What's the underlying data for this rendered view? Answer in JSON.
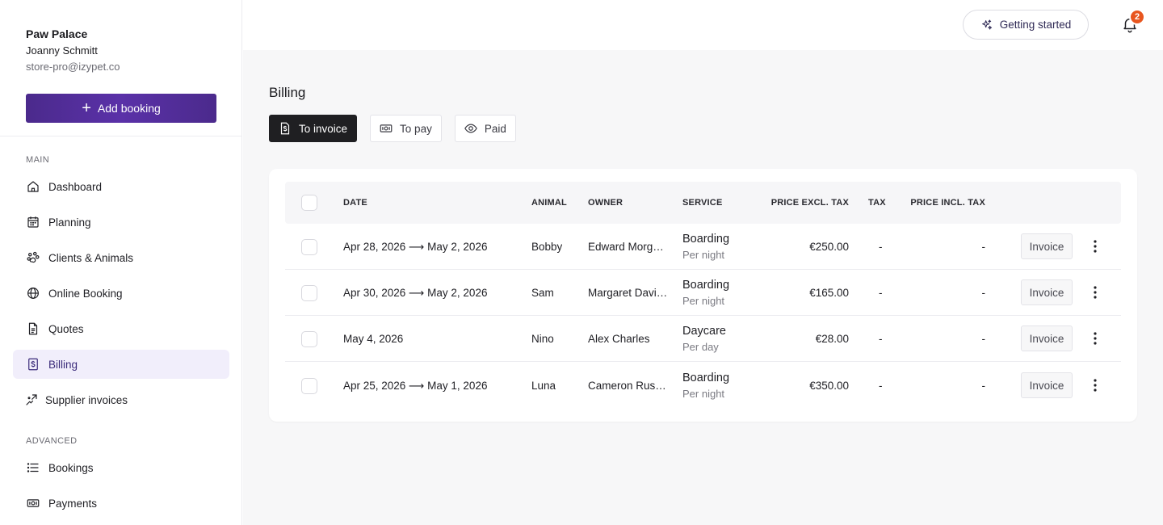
{
  "sidebar": {
    "store_name": "Paw Palace",
    "user_name": "Joanny Schmitt",
    "email": "store-pro@izypet.co",
    "add_booking_label": "Add booking",
    "main_label": "MAIN",
    "advanced_label": "ADVANCED",
    "main_items": [
      {
        "label": "Dashboard",
        "icon": "home-icon"
      },
      {
        "label": "Planning",
        "icon": "calendar-icon"
      },
      {
        "label": "Clients & Animals",
        "icon": "paw-icon"
      },
      {
        "label": "Online Booking",
        "icon": "globe-icon"
      },
      {
        "label": "Quotes",
        "icon": "document-icon"
      },
      {
        "label": "Billing",
        "icon": "dollar-file-icon",
        "active": true
      },
      {
        "label": "Supplier invoices",
        "icon": "supplier-icon"
      }
    ],
    "advanced_items": [
      {
        "label": "Bookings",
        "icon": "list-icon"
      },
      {
        "label": "Payments",
        "icon": "cash-icon"
      }
    ]
  },
  "topbar": {
    "getting_started_label": "Getting started",
    "notification_count": "2"
  },
  "main": {
    "title": "Billing",
    "tabs": [
      {
        "label": "To invoice",
        "icon": "dollar-file-icon",
        "active": true
      },
      {
        "label": "To pay",
        "icon": "cash-icon"
      },
      {
        "label": "Paid",
        "icon": "eye-icon"
      }
    ]
  },
  "table": {
    "headers": {
      "date": "DATE",
      "animal": "ANIMAL",
      "owner": "OWNER",
      "service": "SERVICE",
      "price_excl": "PRICE EXCL. TAX",
      "tax": "TAX",
      "price_incl": "PRICE INCL. TAX"
    },
    "invoice_label": "Invoice",
    "rows": [
      {
        "date": "Apr 28, 2026 ⟶ May 2, 2026",
        "animal": "Bobby",
        "owner": "Edward Morg…",
        "service": "Boarding",
        "unit": "Per night",
        "price_excl": "€250.00",
        "tax": "-",
        "price_incl": "-"
      },
      {
        "date": "Apr 30, 2026 ⟶ May 2, 2026",
        "animal": "Sam",
        "owner": "Margaret Davi…",
        "service": "Boarding",
        "unit": "Per night",
        "price_excl": "€165.00",
        "tax": "-",
        "price_incl": "-"
      },
      {
        "date": "May 4, 2026",
        "animal": "Nino",
        "owner": "Alex Charles",
        "service": "Daycare",
        "unit": "Per day",
        "price_excl": "€28.00",
        "tax": "-",
        "price_incl": "-"
      },
      {
        "date": "Apr 25, 2026 ⟶ May 1, 2026",
        "animal": "Luna",
        "owner": "Cameron Rus…",
        "service": "Boarding",
        "unit": "Per night",
        "price_excl": "€350.00",
        "tax": "-",
        "price_incl": "-"
      }
    ]
  }
}
